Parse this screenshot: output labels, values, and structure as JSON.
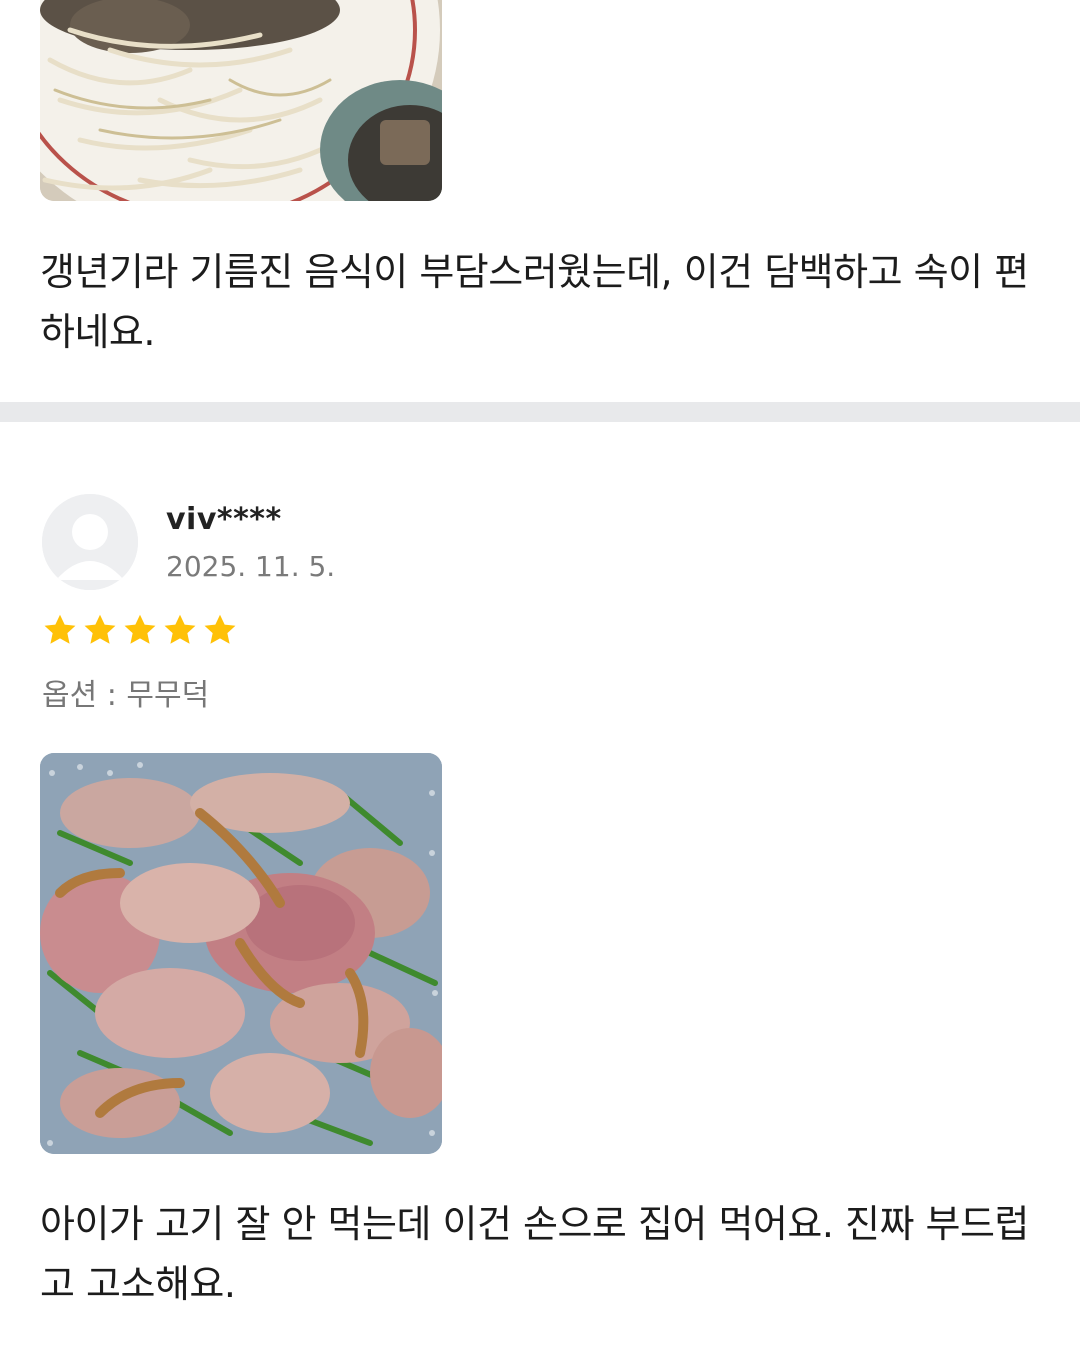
{
  "reviews": [
    {
      "photo_icon": "food-photo-noodles-bean-sprouts",
      "text": "갱년기라 기름진 음식이 부담스러웠는데, 이건 담백하고 속이 편하네요."
    },
    {
      "username": "viv****",
      "date": "2025. 11. 5.",
      "rating": 5,
      "rating_max": 5,
      "option_label": "옵션",
      "option_separator": " : ",
      "option_value": "무무덕",
      "photo_icon": "food-photo-sliced-duck-chives",
      "text": "아이가 고기 잘 안 먹는데 이건 손으로 집어 먹어요. 진짜 부드럽고 고소해요."
    }
  ],
  "colors": {
    "star": "#FFC107",
    "divider": "#E8E9EB",
    "date_text": "#7A7A7A",
    "option_text": "#777777",
    "body_text": "#1C1C1C"
  },
  "icons": {
    "avatar": "default-user-avatar-icon",
    "star": "star-icon"
  }
}
